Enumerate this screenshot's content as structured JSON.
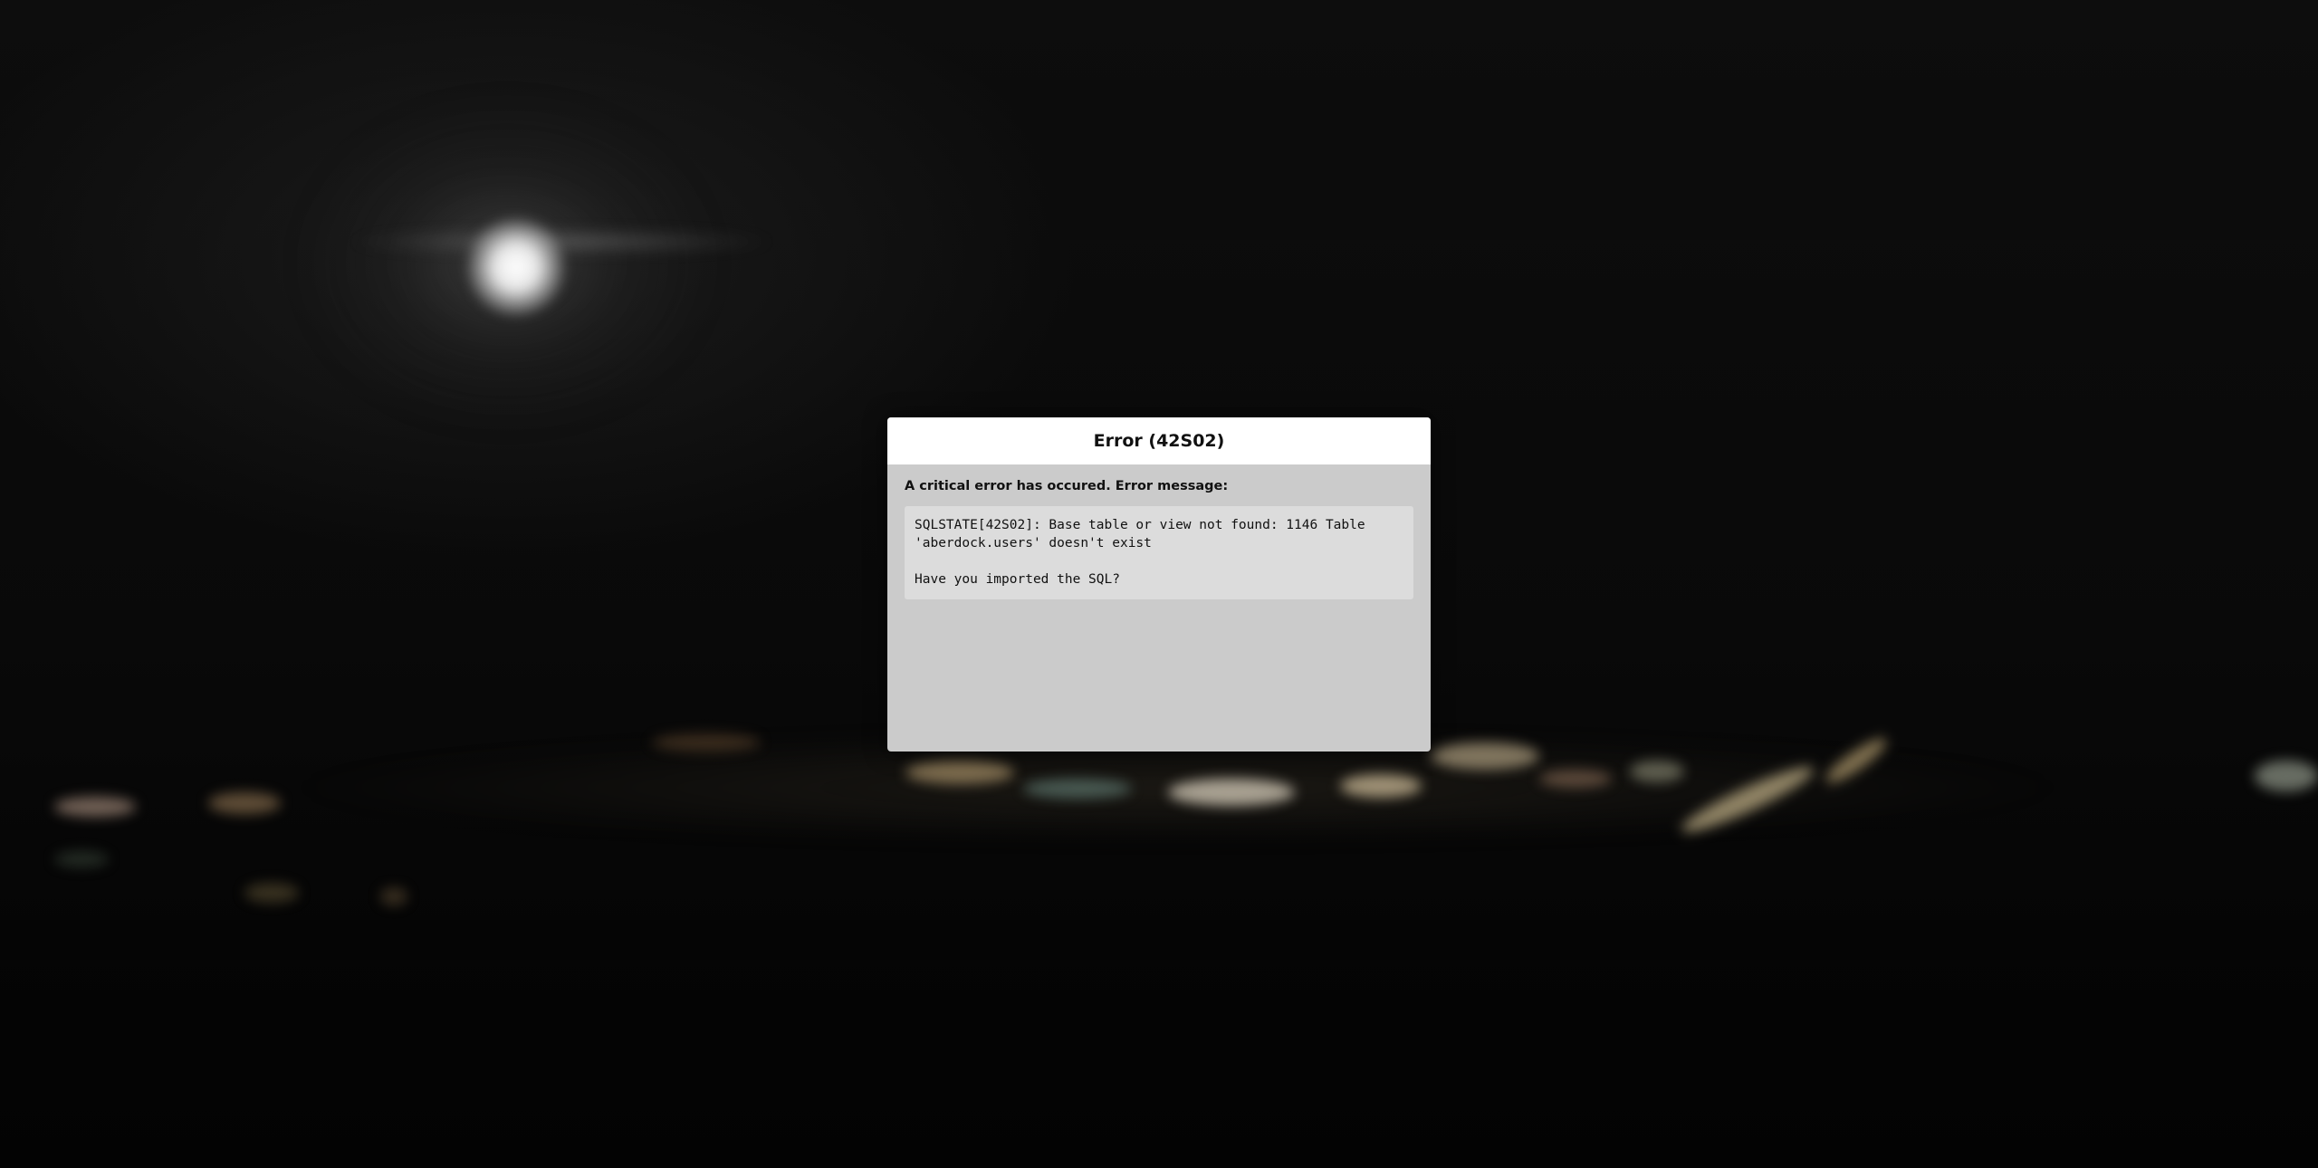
{
  "dialog": {
    "title": "Error (42S02)",
    "intro": "A critical error has occured. Error message:",
    "error_line_1": "SQLSTATE[42S02]: Base table or view not found: 1146 Table",
    "error_line_2": "'aberdock.users' doesn't exist",
    "hint": "Have you imported the SQL?"
  },
  "colors": {
    "dialog_background": "#cbcbcb",
    "dialog_header": "#ffffff",
    "message_box": "#dcdcdc",
    "page_background": "#050505"
  }
}
